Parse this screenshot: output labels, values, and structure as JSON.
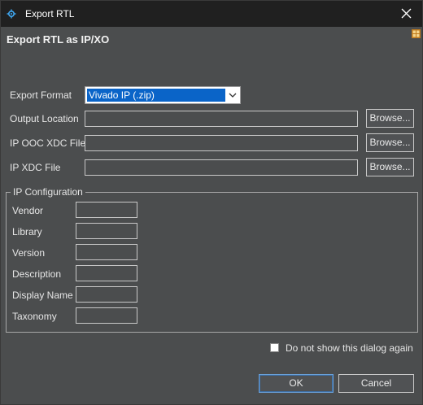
{
  "window": {
    "title": "Export RTL",
    "close_icon": "close-icon",
    "app_icon": "vivado-gear-icon"
  },
  "dialog": {
    "heading": "Export RTL as IP/XO",
    "layout_icon": "grid-icon"
  },
  "export_format": {
    "label": "Export Format",
    "selected": "Vivado IP (.zip)"
  },
  "output_location": {
    "label": "Output Location",
    "value": "",
    "browse": "Browse..."
  },
  "ip_ooc_xdc": {
    "label": "IP OOC XDC File",
    "value": "",
    "browse": "Browse..."
  },
  "ip_xdc": {
    "label": "IP XDC File",
    "value": "",
    "browse": "Browse..."
  },
  "ip_config": {
    "title": "IP Configuration",
    "fields": [
      {
        "label": "Vendor",
        "value": ""
      },
      {
        "label": "Library",
        "value": ""
      },
      {
        "label": "Version",
        "value": ""
      },
      {
        "label": "Description",
        "value": ""
      },
      {
        "label": "Display Name",
        "value": ""
      },
      {
        "label": "Taxonomy",
        "value": ""
      }
    ]
  },
  "dont_show": {
    "label": "Do not show this dialog again",
    "checked": false
  },
  "buttons": {
    "ok": "OK",
    "cancel": "Cancel"
  },
  "colors": {
    "title_bar": "#202020",
    "dialog_bg": "#4b4d4e",
    "selection": "#0a64c8"
  }
}
